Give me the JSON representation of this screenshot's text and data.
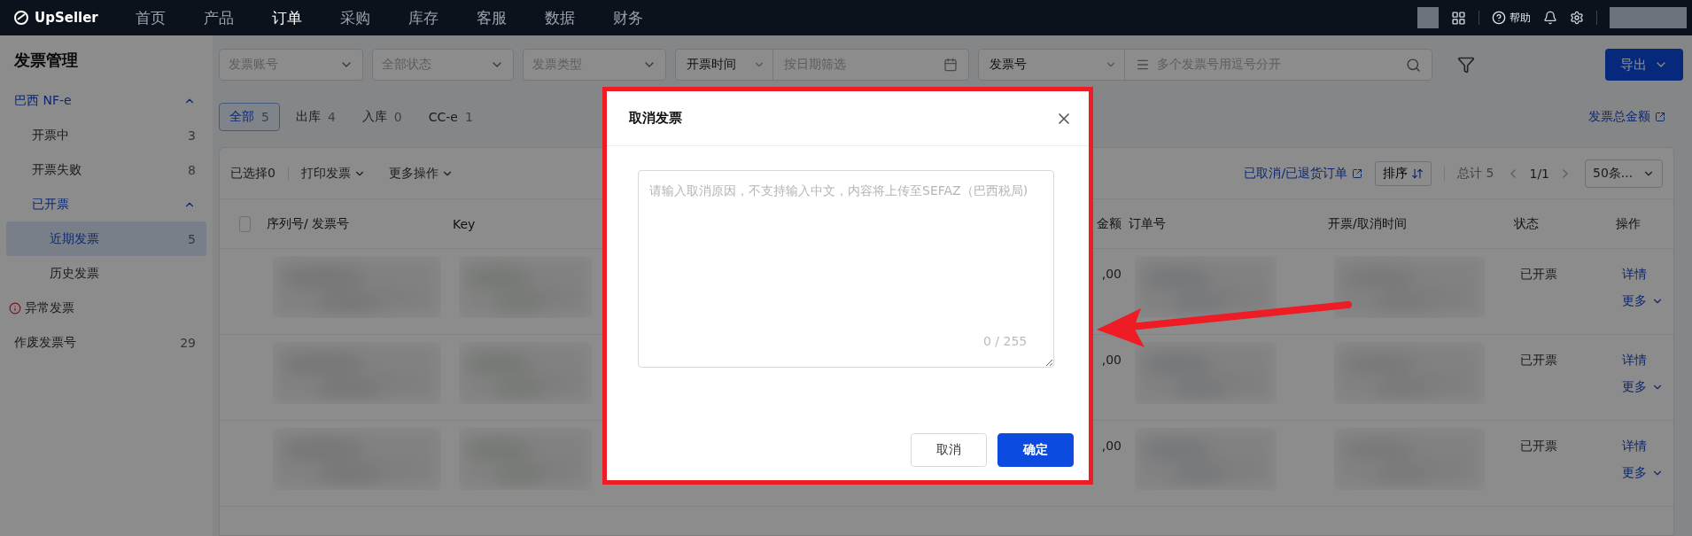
{
  "top_nav": {
    "logo": "UpSeller",
    "items": [
      {
        "label": "首页",
        "selected": false
      },
      {
        "label": "产品",
        "selected": false
      },
      {
        "label": "订单",
        "selected": true
      },
      {
        "label": "采购",
        "selected": false
      },
      {
        "label": "库存",
        "selected": false
      },
      {
        "label": "客服",
        "selected": false
      },
      {
        "label": "数据",
        "selected": false
      },
      {
        "label": "财务",
        "selected": false
      }
    ],
    "help": "帮助"
  },
  "sidebar": {
    "title": "发票管理",
    "items": [
      {
        "label": "巴西 NF-e",
        "kind": "group",
        "expanded": true,
        "selected": false,
        "children": [
          {
            "label": "开票中",
            "count": "3",
            "selected": false
          },
          {
            "label": "开票失败",
            "count": "8",
            "selected": false
          },
          {
            "label": "已开票",
            "kind": "group",
            "expanded": true,
            "selected": false,
            "children": [
              {
                "label": "近期发票",
                "count": "5",
                "selected": true
              },
              {
                "label": "历史发票",
                "selected": false
              }
            ]
          }
        ]
      },
      {
        "label": "异常发票",
        "kind": "warning",
        "selected": false
      },
      {
        "label": "作废发票号",
        "count": "29",
        "selected": false
      }
    ]
  },
  "filters": [
    {
      "kind": "select",
      "placeholder": "发票账号"
    },
    {
      "kind": "select",
      "placeholder": "全部状态"
    },
    {
      "kind": "select",
      "placeholder": "发票类型"
    },
    {
      "kind": "date",
      "prefix": "开票时间",
      "placeholder": "按日期筛选"
    },
    {
      "kind": "search",
      "prefix": "发票号",
      "placeholder": "多个发票号用逗号分开"
    }
  ],
  "export_button": "导出",
  "tabs": [
    {
      "label": "全部",
      "count": "5",
      "selected": true
    },
    {
      "label": "出库",
      "count": "4",
      "selected": false
    },
    {
      "label": "入库",
      "count": "0",
      "selected": false
    },
    {
      "label": "CC-e",
      "count": "1",
      "selected": false
    }
  ],
  "total_amount_link": "发票总金额",
  "toolbar": {
    "selected_count": "已选择0",
    "actions": [
      "打印发票",
      "更多操作"
    ],
    "cancelled_link": "已取消/已退货订单",
    "sort_button": "排序",
    "total": "总计 5",
    "page": "1/1",
    "page_size": "50条..."
  },
  "table": {
    "select_all": {
      "checked": false
    },
    "columns": [
      "序列号/ 发票号",
      "Key",
      "金额",
      "订单号",
      "开票/取消时间",
      "状态",
      "操作"
    ],
    "rows": [
      {
        "amount": ",00",
        "status": "已开票",
        "detail_link": "详情",
        "more_link": "更多"
      },
      {
        "amount": ",00",
        "status": "已开票",
        "detail_link": "详情",
        "more_link": "更多"
      },
      {
        "amount": ",00",
        "status": "已开票",
        "detail_link": "详情",
        "more_link": "更多"
      }
    ]
  },
  "modal": {
    "title": "取消发票",
    "placeholder": "请输入取消原因，不支持输入中文，内容将上传至SEFAZ（巴西税局)",
    "counter": "0 / 255",
    "buttons": [
      {
        "label": "取消",
        "kind": "secondary"
      },
      {
        "label": "确定",
        "kind": "primary"
      }
    ]
  }
}
